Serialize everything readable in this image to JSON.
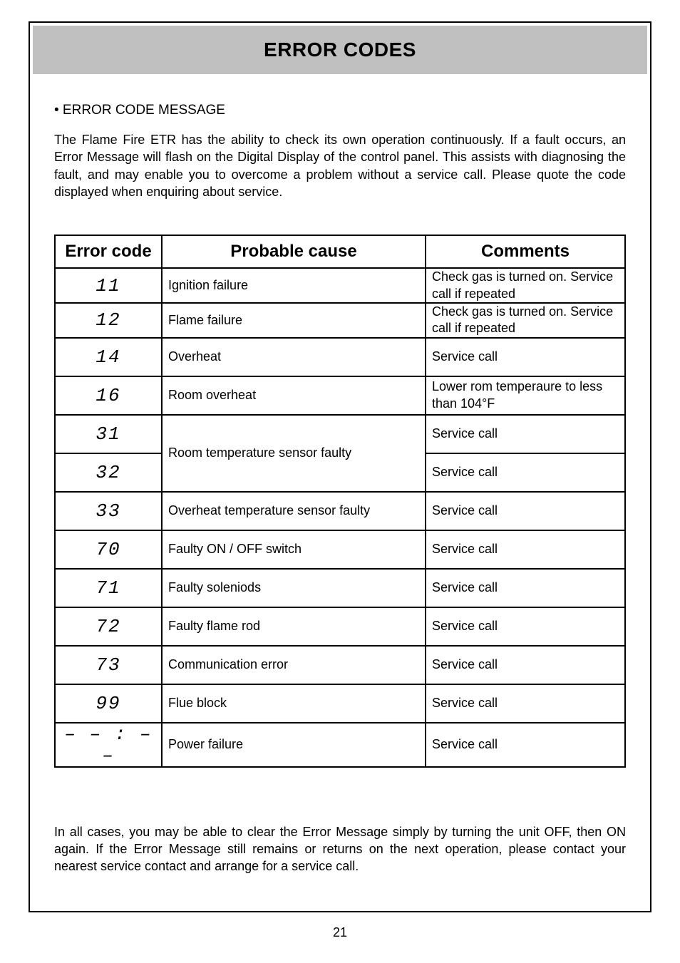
{
  "title": "ERROR CODES",
  "subheading": "•  ERROR CODE MESSAGE",
  "intro": "The Flame Fire ETR has the ability to check its own operation continuously. If a fault occurs, an Error Message will flash on the Digital Display of the control panel. This assists with diagnosing the fault, and may enable you to overcome a problem without a service call. Please quote the code displayed when enquiring about service.",
  "headers": {
    "code": "Error code",
    "cause": "Probable cause",
    "comments": "Comments"
  },
  "rows": [
    {
      "code": "11",
      "cause": "Ignition failure",
      "comment": "Check gas is turned on. Service call if repeated"
    },
    {
      "code": "12",
      "cause": "Flame failure",
      "comment": "Check gas is turned on. Service call if repeated"
    },
    {
      "code": "14",
      "cause": "Overheat",
      "comment": "Service call"
    },
    {
      "code": "16",
      "cause": "Room overheat",
      "comment": "Lower rom temperaure to less than 104°F"
    },
    {
      "code": "31",
      "cause": "Room temperature sensor faulty",
      "comment": "Service call"
    },
    {
      "code": "32",
      "cause": "",
      "comment": "Service call"
    },
    {
      "code": "33",
      "cause": "Overheat temperature sensor faulty",
      "comment": "Service call"
    },
    {
      "code": "70",
      "cause": "Faulty ON / OFF switch",
      "comment": "Service call"
    },
    {
      "code": "71",
      "cause": "Faulty soleniods",
      "comment": "Service call"
    },
    {
      "code": "72",
      "cause": "Faulty flame rod",
      "comment": "Service call"
    },
    {
      "code": "73",
      "cause": "Communication error",
      "comment": "Service call"
    },
    {
      "code": "99",
      "cause": "Flue block",
      "comment": "Service call"
    },
    {
      "code": "– – : – –",
      "cause": "Power failure",
      "comment": "Service call"
    }
  ],
  "footer": "In all cases, you may be able to clear the Error Message simply by turning the unit OFF, then ON again. If the Error Message still remains or returns on the next operation, please contact your nearest service contact and arrange for a service call.",
  "pageNumber": "21"
}
